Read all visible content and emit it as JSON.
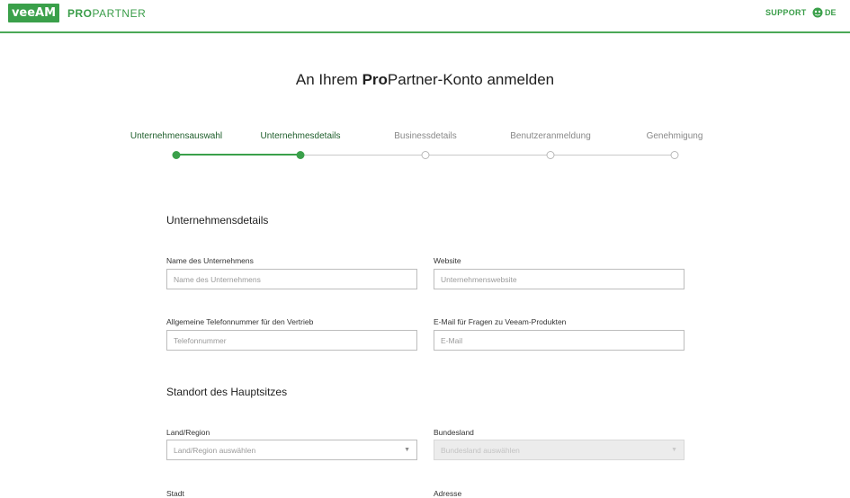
{
  "header": {
    "logo_text": "veeAM",
    "brand_pro": "PRO",
    "brand_partner": "PARTNER",
    "support_label": "SUPPORT",
    "language_label": "DE",
    "accent_color": "#3aa04a"
  },
  "title": {
    "prefix": "An Ihrem ",
    "bold": "Pro",
    "suffix": "Partner-Konto anmelden"
  },
  "stepper": {
    "steps": [
      {
        "label": "Unternehmensauswahl",
        "state": "done"
      },
      {
        "label": "Unternehmesdetails",
        "state": "current"
      },
      {
        "label": "Businessdetails",
        "state": "pending"
      },
      {
        "label": "Benutzeranmeldung",
        "state": "pending"
      },
      {
        "label": "Genehmigung",
        "state": "pending"
      }
    ]
  },
  "company_section": {
    "title": "Unternehmensdetails",
    "company_name": {
      "label": "Name des Unternehmens",
      "placeholder": "Name des Unternehmens",
      "value": ""
    },
    "website": {
      "label": "Website",
      "placeholder": "Unternehmenswebsite",
      "value": ""
    },
    "phone": {
      "label": "Allgemeine Telefonnummer für den Vertrieb",
      "placeholder": "Telefonnummer",
      "value": ""
    },
    "email": {
      "label": "E-Mail für Fragen zu Veeam-Produkten",
      "placeholder": "E-Mail",
      "value": ""
    }
  },
  "hq_section": {
    "title": "Standort des Hauptsitzes",
    "country": {
      "label": "Land/Region",
      "selected": "Land/Region auswählen"
    },
    "state": {
      "label": "Bundesland",
      "selected": "Bundesland auswählen",
      "disabled": true
    },
    "city": {
      "label": "Stadt"
    },
    "address": {
      "label": "Adresse"
    }
  }
}
